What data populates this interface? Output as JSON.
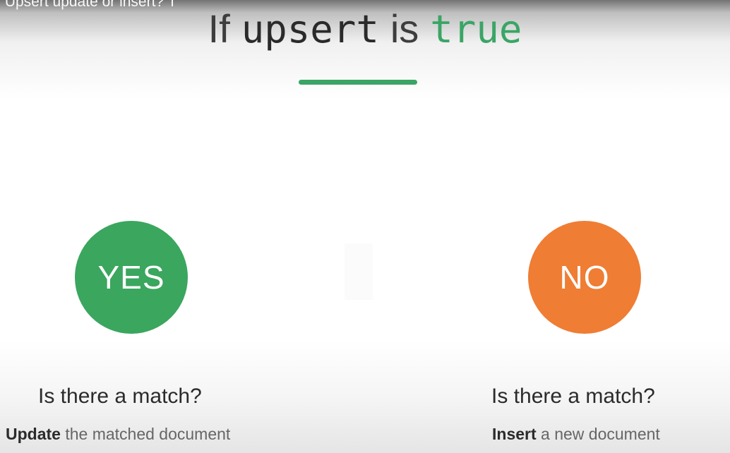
{
  "video": {
    "title": "r Upsert update or insert? T"
  },
  "slide": {
    "title": {
      "prefix": "If",
      "keyword": "upsert",
      "middle": "is",
      "value": "true",
      "value_color": "#3aa565"
    },
    "options": [
      {
        "label": "YES",
        "color": "#3aa65e",
        "question": "Is there a match?",
        "answer_action": "Update",
        "answer_rest": " the matched document"
      },
      {
        "label": "NO",
        "color": "#ef7d34",
        "question": "Is there a match?",
        "answer_action": "Insert",
        "answer_rest": " a new document"
      }
    ]
  }
}
